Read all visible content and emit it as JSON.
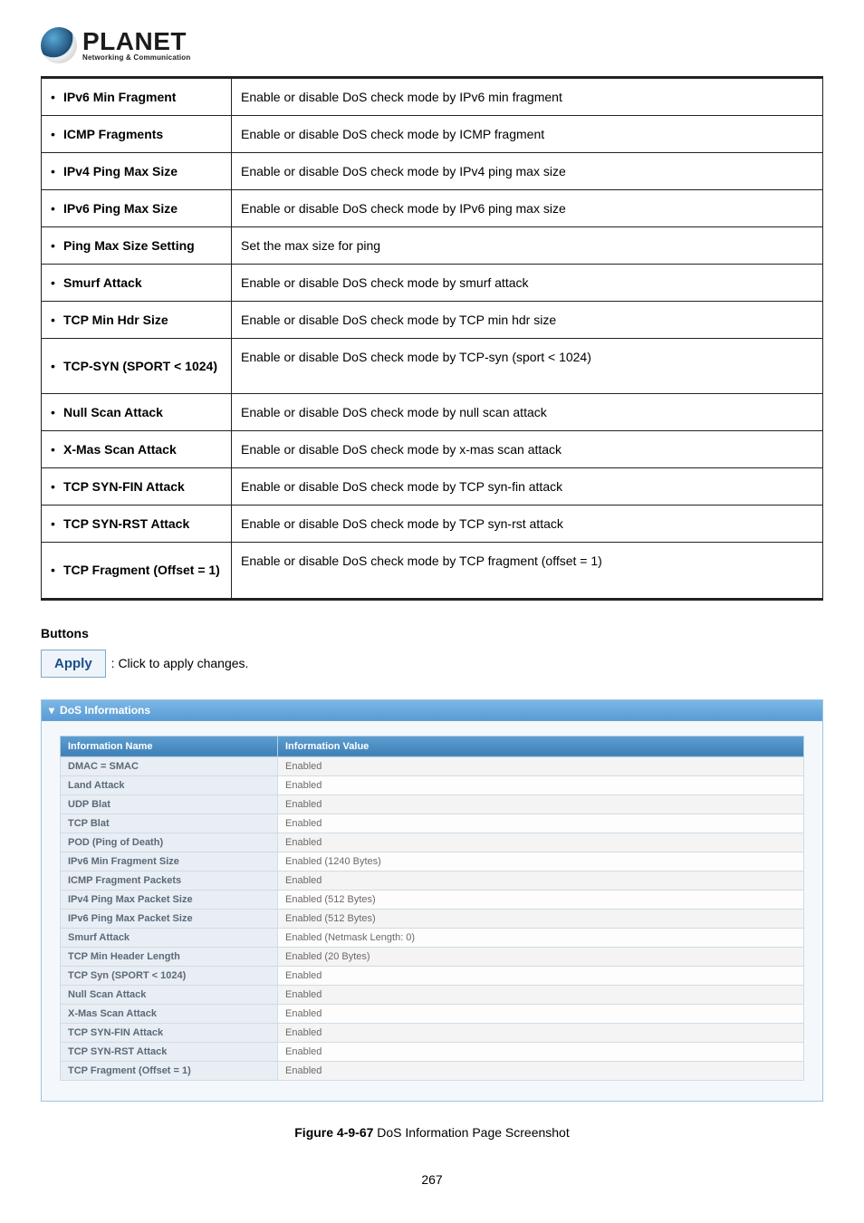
{
  "logo": {
    "name": "PLANET",
    "tagline": "Networking & Communication"
  },
  "defs": [
    {
      "term": "IPv6 Min Fragment",
      "desc": "Enable or disable DoS check mode by IPv6 min fragment"
    },
    {
      "term": "ICMP Fragments",
      "desc": "Enable or disable DoS check mode by ICMP fragment"
    },
    {
      "term": "IPv4 Ping Max Size",
      "desc": "Enable or disable DoS check mode by IPv4 ping max size"
    },
    {
      "term": "IPv6 Ping Max Size",
      "desc": "Enable or disable DoS check mode by IPv6 ping max size"
    },
    {
      "term": "Ping Max Size Setting",
      "desc": "Set the max size for ping"
    },
    {
      "term": "Smurf Attack",
      "desc": "Enable or disable DoS check mode by smurf attack"
    },
    {
      "term": "TCP Min Hdr Size",
      "desc": "Enable or disable DoS check mode by TCP min hdr size"
    },
    {
      "term": "TCP-SYN (SPORT < 1024)",
      "desc": "Enable or disable DoS check mode by TCP-syn (sport < 1024)"
    },
    {
      "term": "Null Scan Attack",
      "desc": "Enable or disable DoS check mode by null scan attack"
    },
    {
      "term": "X-Mas Scan Attack",
      "desc": "Enable or disable DoS check mode by x-mas scan attack"
    },
    {
      "term": "TCP SYN-FIN Attack",
      "desc": "Enable or disable DoS check mode by TCP syn-fin attack"
    },
    {
      "term": "TCP SYN-RST Attack",
      "desc": "Enable or disable DoS check mode by TCP syn-rst attack"
    },
    {
      "term": "TCP Fragment (Offset = 1)",
      "desc": "Enable or disable DoS check mode by TCP fragment (offset = 1)"
    }
  ],
  "buttons_heading": "Buttons",
  "apply_label": "Apply",
  "apply_desc": ": Click to apply changes.",
  "panel_title": "DoS Informations",
  "info_headers": {
    "name": "Information Name",
    "value": "Information Value"
  },
  "info_rows": [
    {
      "name": "DMAC = SMAC",
      "value": "Enabled"
    },
    {
      "name": "Land Attack",
      "value": "Enabled"
    },
    {
      "name": "UDP Blat",
      "value": "Enabled"
    },
    {
      "name": "TCP Blat",
      "value": "Enabled"
    },
    {
      "name": "POD (Ping of Death)",
      "value": "Enabled"
    },
    {
      "name": "IPv6 Min Fragment Size",
      "value": "Enabled (1240 Bytes)"
    },
    {
      "name": "ICMP Fragment Packets",
      "value": "Enabled"
    },
    {
      "name": "IPv4 Ping Max Packet Size",
      "value": "Enabled (512 Bytes)"
    },
    {
      "name": "IPv6 Ping Max Packet Size",
      "value": "Enabled (512 Bytes)"
    },
    {
      "name": "Smurf Attack",
      "value": "Enabled (Netmask Length: 0)"
    },
    {
      "name": "TCP Min Header Length",
      "value": "Enabled (20 Bytes)"
    },
    {
      "name": "TCP Syn (SPORT < 1024)",
      "value": "Enabled"
    },
    {
      "name": "Null Scan Attack",
      "value": "Enabled"
    },
    {
      "name": "X-Mas Scan Attack",
      "value": "Enabled"
    },
    {
      "name": "TCP SYN-FIN Attack",
      "value": "Enabled"
    },
    {
      "name": "TCP SYN-RST Attack",
      "value": "Enabled"
    },
    {
      "name": "TCP Fragment (Offset = 1)",
      "value": "Enabled"
    }
  ],
  "figure": {
    "label": "Figure 4-9-67",
    "caption": " DoS Information Page Screenshot"
  },
  "page_number": "267"
}
